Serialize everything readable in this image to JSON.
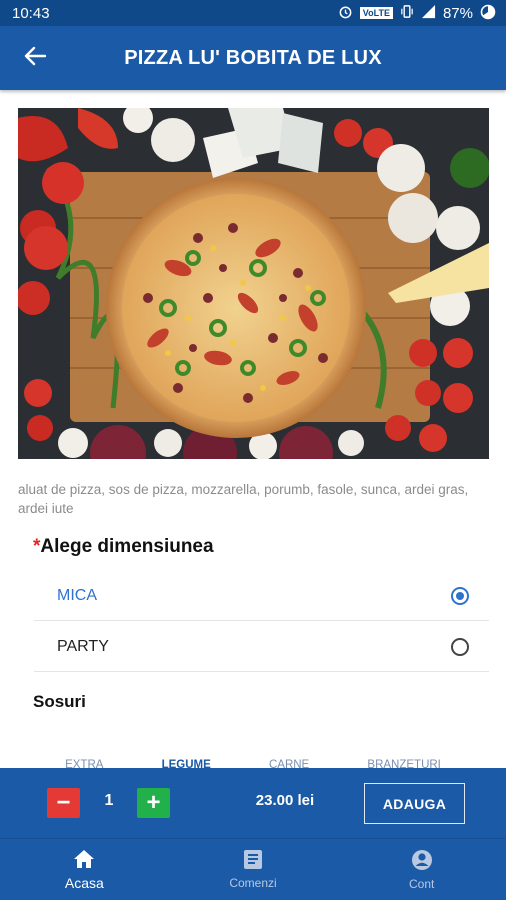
{
  "status_bar": {
    "time": "10:43",
    "network_label": "VoLTE",
    "battery": "87%"
  },
  "app_bar": {
    "title": "PIZZA LU' BOBITA DE LUX"
  },
  "product": {
    "description": "aluat de pizza, sos de pizza, mozzarella, porumb, fasole, sunca, ardei gras, ardei iute"
  },
  "size_section": {
    "required_mark": "*",
    "title": "Alege dimensiunea",
    "options": [
      {
        "label": "MICA",
        "selected": true
      },
      {
        "label": "PARTY",
        "selected": false
      }
    ]
  },
  "sauces": {
    "title": "Sosuri",
    "tabs": [
      "EXTRA",
      "LEGUME",
      "CARNE",
      "BRANZETURI"
    ],
    "active_tab": "LEGUME"
  },
  "cart": {
    "minus": "−",
    "plus": "+",
    "quantity": "1",
    "price": "23.00 lei",
    "add_label": "ADAUGA"
  },
  "bottom_nav": {
    "items": [
      {
        "label": "Acasa",
        "icon": "home-icon",
        "active": true
      },
      {
        "label": "Comenzi",
        "icon": "orders-icon",
        "active": false
      },
      {
        "label": "Cont",
        "icon": "account-icon",
        "active": false
      }
    ]
  },
  "colors": {
    "primary": "#1a5aa6",
    "status_bar": "#10498a",
    "selected": "#2f73d0",
    "minus_button": "#e53935",
    "plus_button": "#22b04b",
    "required": "#e12525"
  }
}
